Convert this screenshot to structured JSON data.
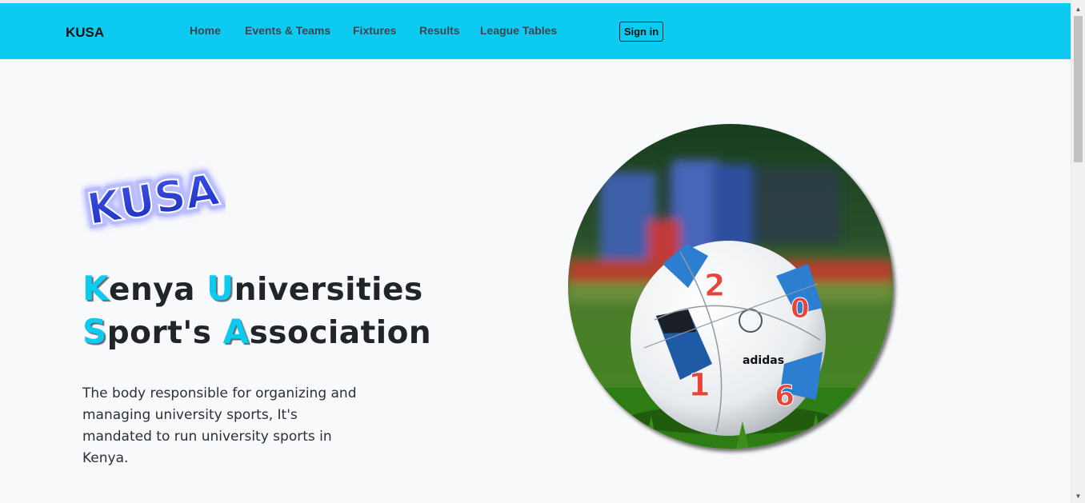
{
  "navbar": {
    "brand": "KUSA",
    "links": [
      "Home",
      "Events & Teams",
      "Fixtures",
      "Results",
      "League Tables"
    ],
    "signin_label": "Sign in"
  },
  "hero": {
    "logo_text": "KUSA",
    "heading": {
      "line1": [
        {
          "cap": "K",
          "rest": "enya "
        },
        {
          "cap": "U",
          "rest": "niversities"
        }
      ],
      "line2": [
        {
          "cap": "S",
          "rest": "port's "
        },
        {
          "cap": "A",
          "rest": "ssociation"
        }
      ]
    },
    "description": "The body responsible for organizing and managing university sports, It's mandated to run university sports in Kenya.",
    "image_label": "soccer-ball-on-grass",
    "ball_print": {
      "brand": "adidas",
      "numbers": [
        "2",
        "0",
        "1",
        "6"
      ]
    }
  },
  "colors": {
    "navbar": "#0dcaf0",
    "accent": "#0dcaf0",
    "text": "#212529",
    "background": "#f8f9fb"
  }
}
